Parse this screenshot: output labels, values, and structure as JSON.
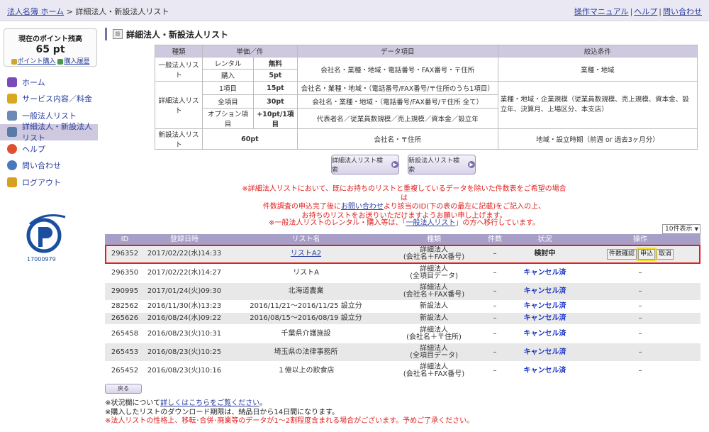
{
  "breadcrumb": {
    "home": "法人名簿 ホーム",
    "sep": " > ",
    "current": "詳細法人・新設法人リスト"
  },
  "toplinks": {
    "manual": "操作マニュアル",
    "help": "ヘルプ",
    "contact": "問い合わせ"
  },
  "points": {
    "label": "現在のポイント残高",
    "value": "65 pt",
    "buy": "ポイント購入",
    "history": "購入履歴"
  },
  "nav": [
    {
      "label": "ホーム",
      "icon": "home-icon",
      "color": "#7a4ab8"
    },
    {
      "label": "サービス内容／料金",
      "icon": "coins-icon",
      "color": "#d8a820"
    },
    {
      "label": "一般法人リスト",
      "icon": "building-icon",
      "color": "#6a8ab8"
    },
    {
      "label": "詳細法人・新設法人リスト",
      "icon": "buildings-icon",
      "color": "#5a7aa8"
    },
    {
      "label": "ヘルプ",
      "icon": "lifebuoy-icon",
      "color": "#e05030"
    },
    {
      "label": "問い合わせ",
      "icon": "person-icon",
      "color": "#4a78c0"
    },
    {
      "label": "ログアウト",
      "icon": "logout-icon",
      "color": "#d8a020"
    }
  ],
  "privacy": {
    "top": "たいせつにしますプライバシー",
    "number": "17000979"
  },
  "page_title": "詳細法人・新設法人リスト",
  "title_icon_text": "設",
  "price_table": {
    "headers": [
      "種類",
      "単価／件",
      "データ項目",
      "絞込条件"
    ],
    "general": {
      "type": "一般法人リスト",
      "rental": "レンタル",
      "rental_price": "無料",
      "buy": "購入",
      "buy_price": "5pt",
      "data": "会社名・業種・地域・電話番号・FAX番号・〒住所",
      "filter": "業種・地域"
    },
    "detail": {
      "type": "詳細法人リスト",
      "r1": "1項目",
      "r1_price": "15pt",
      "r1_data": "会社名・業種・地域・（電話番号/FAX番号/〒住所のうち1項目）",
      "r2": "全項目",
      "r2_price": "30pt",
      "r2_data": "会社名・業種・地域・（電話番号/FAX番号/〒住所 全て）",
      "r3": "オプション項目",
      "r3_price": "+10pt/1項目",
      "r3_data": "代表者名／従業員数規模／売上規模／資本金／設立年",
      "filter": "業種・地域・企業規模（従業員数規模、売上規模、資本金、設立年、決算月、上場区分、本支店）"
    },
    "new": {
      "type": "新設法人リスト",
      "price": "60pt",
      "data": "会社名・〒住所",
      "filter": "地域・設立時期（前週 or 過去3ヶ月分）"
    }
  },
  "buttons": {
    "detail_search": "詳細法人リスト検索",
    "new_search": "新設法人リスト検索",
    "back": "戻る"
  },
  "notice": {
    "line1": "※詳細法人リストにおいて、既にお持ちのリストと重複しているデータを除いた件数表をご希望の場合は",
    "line2a": "件数調査の申込完了後に",
    "line2_link": "お問い合わせ",
    "line2b": "より該当のID(下の表の最左に記載)をご記入の上、",
    "line3": "お持ちのリストをお送りいただけますようお願い申し上げます。",
    "line4a": "※一般法人リストのレンタル・購入等は、「",
    "line4_link": "一般法人リスト",
    "line4b": "」の方へ移行しています。"
  },
  "page_size": "10件表示",
  "list": {
    "headers": {
      "id": "ID",
      "date": "登録日時",
      "name": "リスト名",
      "type": "種類",
      "count": "件数",
      "status": "状況",
      "op": "操作"
    },
    "rows": [
      {
        "id": "296352",
        "date": "2017/02/22(水)14:33",
        "name": "リストA2",
        "type1": "詳細法人",
        "type2": "(会社名＋FAX番号)",
        "count": "–",
        "status": "検討中",
        "ops": [
          "件数確認",
          "申込",
          "取消"
        ]
      },
      {
        "id": "296350",
        "date": "2017/02/22(水)14:27",
        "name": "リストA",
        "type1": "詳細法人",
        "type2": "(全項目データ)",
        "count": "–",
        "status": "キャンセル済",
        "op": "–"
      },
      {
        "id": "290995",
        "date": "2017/01/24(火)09:30",
        "name": "北海道農業",
        "type1": "詳細法人",
        "type2": "(会社名＋FAX番号)",
        "count": "–",
        "status": "キャンセル済",
        "op": "–"
      },
      {
        "id": "282562",
        "date": "2016/11/30(水)13:23",
        "name": "2016/11/21～2016/11/25 設立分",
        "type1": "新設法人",
        "type2": "",
        "count": "–",
        "status": "キャンセル済",
        "op": "–"
      },
      {
        "id": "265626",
        "date": "2016/08/24(水)09:22",
        "name": "2016/08/15～2016/08/19 設立分",
        "type1": "新設法人",
        "type2": "",
        "count": "–",
        "status": "キャンセル済",
        "op": "–"
      },
      {
        "id": "265458",
        "date": "2016/08/23(火)10:31",
        "name": "千葉県介護施設",
        "type1": "詳細法人",
        "type2": "(会社名＋〒住所)",
        "count": "–",
        "status": "キャンセル済",
        "op": "–"
      },
      {
        "id": "265453",
        "date": "2016/08/23(火)10:25",
        "name": "埼玉県の法律事務所",
        "type1": "詳細法人",
        "type2": "(全項目データ)",
        "count": "–",
        "status": "キャンセル済",
        "op": "–"
      },
      {
        "id": "265452",
        "date": "2016/08/23(火)10:16",
        "name": "１億以上の飲食店",
        "type1": "詳細法人",
        "type2": "(会社名＋FAX番号)",
        "count": "–",
        "status": "キャンセル済",
        "op": "–"
      }
    ]
  },
  "footnotes": {
    "l1a": "※状況欄について",
    "l1_link": "詳しくはこちらをご覧ください",
    "l1b": "。",
    "l2": "※購入したリストのダウンロード期限は、納品日から14日間になります。",
    "l3": "※法人リストの性格上、移転･合併･廃業等のデータが1～2割程度含まれる場合がございます。予めご了承ください。"
  }
}
